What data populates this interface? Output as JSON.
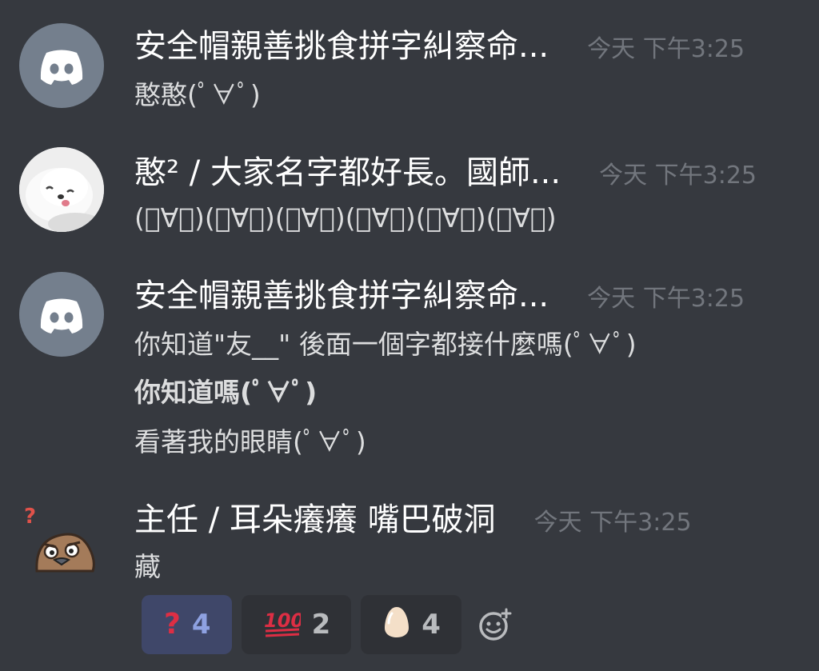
{
  "messages": [
    {
      "username": "安全帽親善挑食拼字糾察命...",
      "timestamp": "今天 下午3:25",
      "lines": [
        "憨憨(ﾟ∀ﾟ)"
      ]
    },
    {
      "username": "憨² / 大家名字都好長。國師...",
      "timestamp": "今天 下午3:25",
      "lines": [
        "(ﾟ∀ﾟ)(ﾟ∀ﾟ)(ﾟ∀ﾟ)(ﾟ∀ﾟ)(ﾟ∀ﾟ)(ﾟ∀ﾟ)"
      ]
    },
    {
      "username": "安全帽親善挑食拼字糾察命...",
      "timestamp": "今天 下午3:25",
      "lines": [
        "你知道\"友__\" 後面一個字都接什麼嗎(ﾟ∀ﾟ)",
        "你知道嗎(ﾟ∀ﾟ)",
        "看著我的眼睛(ﾟ∀ﾟ)"
      ]
    },
    {
      "username": "主任 / 耳朵癢癢 嘴巴破洞",
      "timestamp": "今天 下午3:25",
      "lines": [
        "藏"
      ]
    }
  ],
  "reactions": [
    {
      "emoji": "question-mark-icon",
      "glyph": "❓",
      "count": "4",
      "active": true
    },
    {
      "emoji": "hundred-points-icon",
      "glyph": "💯",
      "count": "2",
      "active": false
    },
    {
      "emoji": "egg-icon",
      "glyph": "🥚",
      "count": "4",
      "active": false
    }
  ],
  "colors": {
    "background": "#36393f",
    "username": "#ffffff",
    "timestamp": "#72767d",
    "message_text": "#dcddde",
    "discord_avatar": "#747f8d",
    "active_reaction": "#3f4769",
    "active_reaction_count": "#8ea1e1"
  }
}
